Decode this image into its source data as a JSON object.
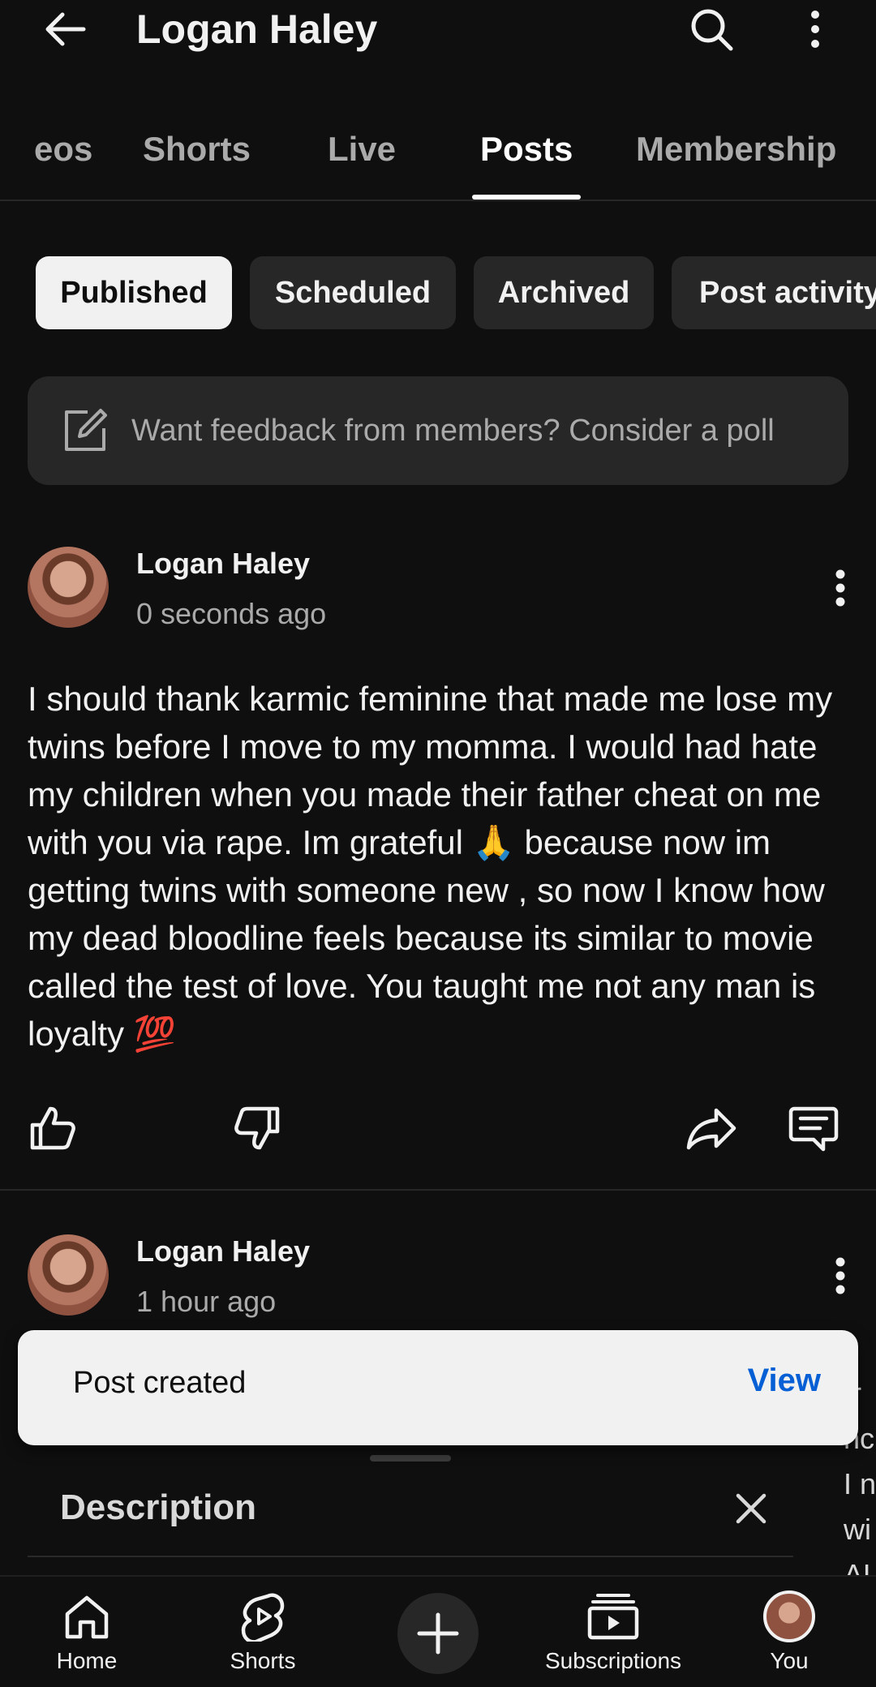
{
  "header": {
    "title": "Logan Haley"
  },
  "tabs": [
    {
      "label": "eos"
    },
    {
      "label": "Shorts"
    },
    {
      "label": "Live"
    },
    {
      "label": "Posts"
    },
    {
      "label": "Membership"
    }
  ],
  "chips": [
    {
      "label": "Published"
    },
    {
      "label": "Scheduled"
    },
    {
      "label": "Archived"
    },
    {
      "label": "Post activity"
    }
  ],
  "feedback": {
    "text": "Want feedback from members? Consider a poll"
  },
  "posts": [
    {
      "author": "Logan Haley",
      "time": "0 seconds ago",
      "body": "I should thank karmic feminine that made me lose my twins before I move to my momma.  I would had hate my children when you made their father cheat on me with you via rape. Im grateful 🙏 because now im getting twins with someone new , so now I know how my dead bloodline feels because its similar to movie called the test of love. You taught me not any man is loyalty 💯"
    },
    {
      "author": "Logan Haley",
      "time": "1 hour ago"
    }
  ],
  "snackbar": {
    "message": "Post created",
    "action": "View"
  },
  "sheet": {
    "title": "Description"
  },
  "side_fragment": "ır\nnc\nI n\nwi\nAL",
  "bottom_nav": [
    {
      "label": "Home"
    },
    {
      "label": "Shorts"
    },
    {
      "label": "Subscriptions"
    },
    {
      "label": "You"
    }
  ]
}
